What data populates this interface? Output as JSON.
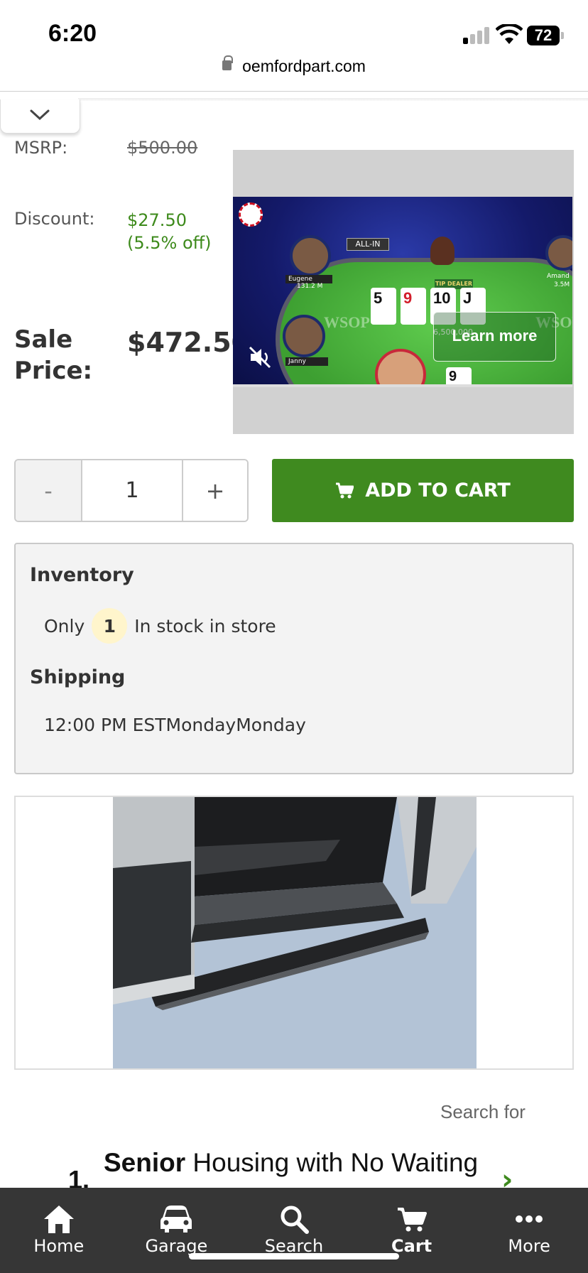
{
  "status_bar": {
    "time": "6:20",
    "battery": "72"
  },
  "browser": {
    "url": "oemfordpart.com"
  },
  "pricing": {
    "msrp_label": "MSRP:",
    "msrp_value": "$500.00",
    "discount_label": "Discount:",
    "discount_amount": "$27.50",
    "discount_percent": "(5.5% off)",
    "sale_label": "Sale Price:",
    "sale_value": "$472.50"
  },
  "ad": {
    "learn_more": "Learn more",
    "card_labels": [
      "5",
      "9",
      "10",
      "J"
    ],
    "badge_text": "ALL-IN",
    "player_names": [
      "Eugene",
      "Janny",
      "Amand"
    ],
    "felt_text": "WSOP",
    "pot_amount": "6,500,000",
    "tip_label": "TIP DEALER",
    "chip_amount": "131.2 M",
    "chip_amount_right": "3.5M",
    "card_bottom": "9"
  },
  "purchase": {
    "decrement_label": "-",
    "quantity": "1",
    "increment_label": "+",
    "add_to_cart_label": "ADD TO CART"
  },
  "inventory": {
    "heading": "Inventory",
    "prefix": "Only",
    "count": "1",
    "suffix": "In stock in store",
    "shipping_heading": "Shipping",
    "shipping_text": "12:00 PM ESTMondayMonday"
  },
  "sponsored": {
    "search_for": "Search for",
    "item_number": "1.",
    "item_bold": "Senior",
    "item_rest": " Housing with No Waiting"
  },
  "bottom_nav": {
    "items": [
      {
        "label": "Home",
        "icon": "home-icon"
      },
      {
        "label": "Garage",
        "icon": "car-icon"
      },
      {
        "label": "Search",
        "icon": "search-icon"
      },
      {
        "label": "Cart",
        "icon": "cart-icon"
      },
      {
        "label": "More",
        "icon": "more-icon"
      }
    ]
  },
  "colors": {
    "accent_green": "#3f8a1f",
    "discount_green": "#3d8a1b",
    "nav_background": "#363636"
  }
}
